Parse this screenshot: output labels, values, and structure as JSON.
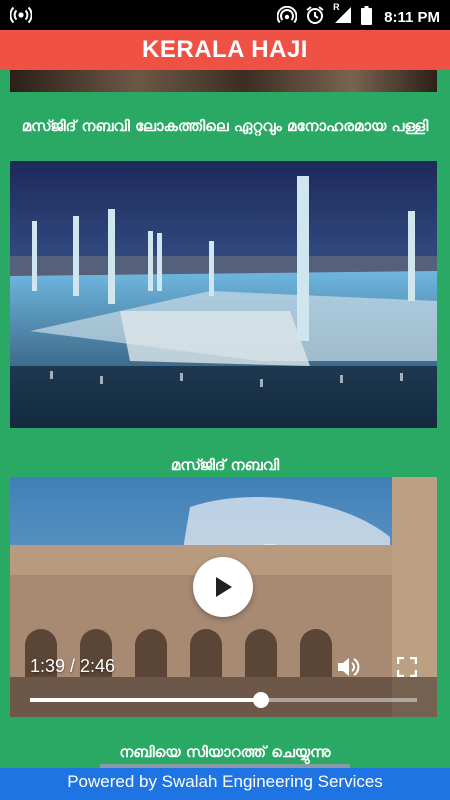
{
  "status_bar": {
    "time": "8:11 PM",
    "roaming_indicator": "R",
    "icons": [
      "radio-icon",
      "hotspot-icon",
      "alarm-icon",
      "signal-icon",
      "battery-icon"
    ]
  },
  "app_bar": {
    "title": "KERALA HAJI",
    "color": "#ef5145"
  },
  "feed": {
    "background": "#2aa965",
    "items": [
      {
        "caption": "മസ്ജിദ് നബവി ലോകത്തിലെ ഏറ്റവും മനോഹരമായ പള്ളി"
      },
      {
        "caption": "മസ്ജിദ് നബവി"
      },
      {
        "caption": "നബിയെ സിയാറത്ത് ചെയ്യുന്നു"
      }
    ]
  },
  "video": {
    "time_display": "1:39 / 2:46",
    "progress": 0.597
  },
  "footer": {
    "text": "Powered by Swalah Engineering Services",
    "color": "#1f74e4"
  }
}
